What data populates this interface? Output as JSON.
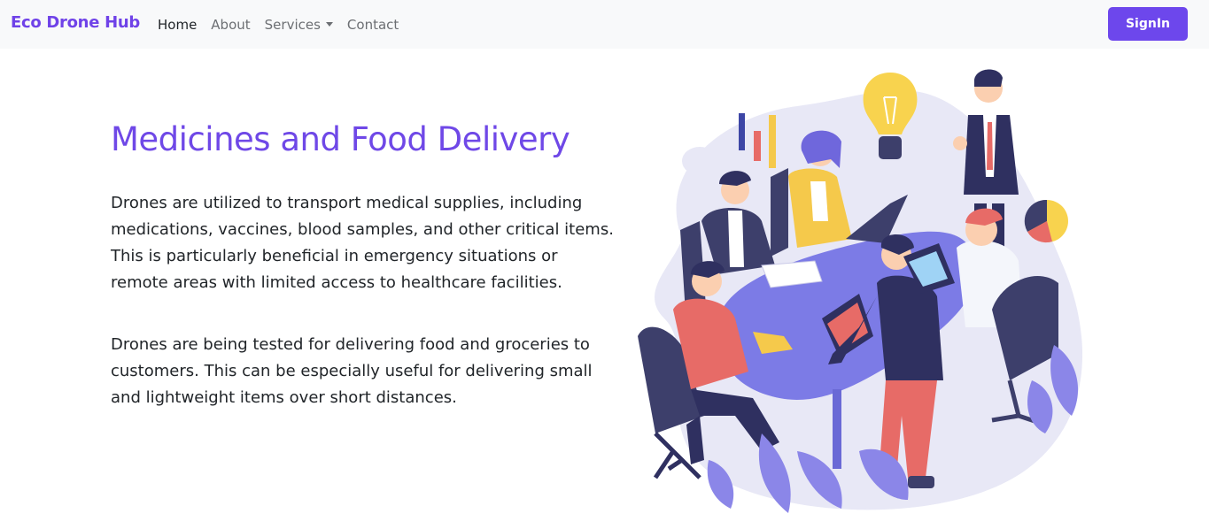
{
  "nav": {
    "brand": "Eco Drone Hub",
    "links": [
      {
        "label": "Home"
      },
      {
        "label": "About"
      },
      {
        "label": "Services"
      },
      {
        "label": "Contact"
      }
    ],
    "signin_label": "SignIn"
  },
  "hero": {
    "title": "Medicines and Food Delivery",
    "paragraphs": [
      "Drones are utilized to transport medical supplies, including medications, vaccines, blood samples, and other critical items. This is particularly beneficial in emergency situations or remote areas with limited access to healthcare facilities.",
      "Drones are being tested for delivering food and groceries to customers. This can be especially useful for delivering small and lightweight items over short distances."
    ]
  },
  "colors": {
    "brand": "#6f42e8",
    "button": "#6d47ec",
    "title": "#6f48e7",
    "navbar_bg": "#f8f9fa"
  }
}
